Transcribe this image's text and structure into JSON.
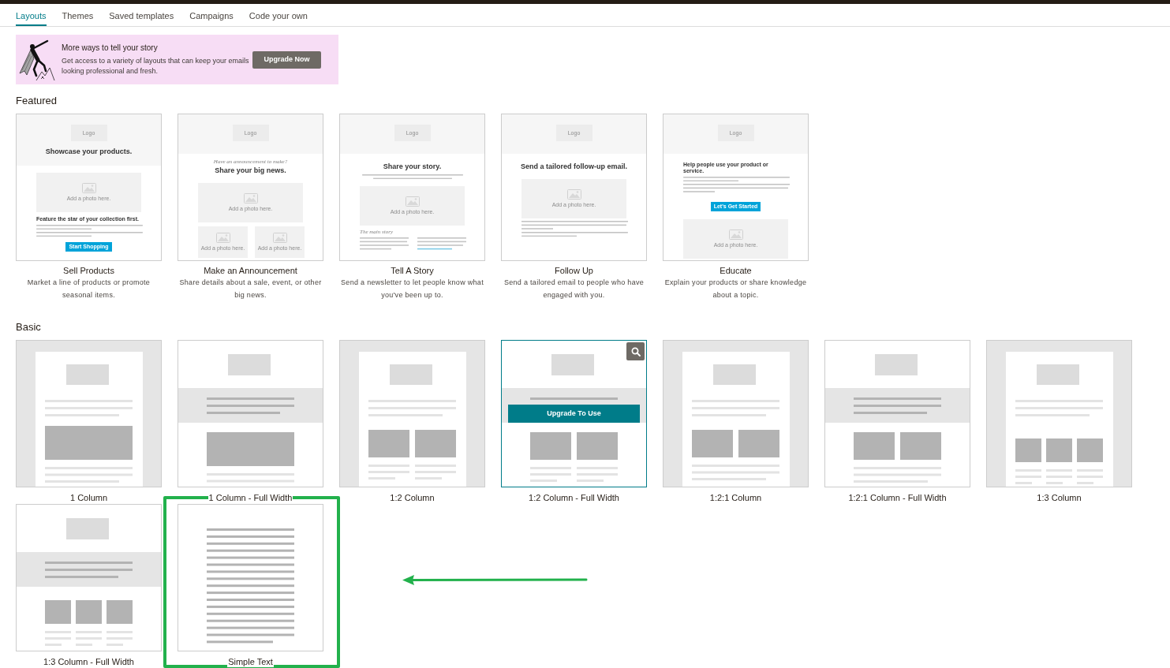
{
  "tabs": [
    {
      "label": "Layouts",
      "selected": true
    },
    {
      "label": "Themes",
      "selected": false
    },
    {
      "label": "Saved templates",
      "selected": false
    },
    {
      "label": "Campaigns",
      "selected": false
    },
    {
      "label": "Code your own",
      "selected": false
    }
  ],
  "upgrade_banner": {
    "title": "More ways to tell your story",
    "text": "Get access to a variety of layouts that can keep your emails looking professional and fresh.",
    "button": "Upgrade Now"
  },
  "featured": {
    "heading": "Featured",
    "templates": [
      {
        "name": "Sell Products",
        "description": "Market a line of products or promote seasonal items.",
        "preview": [
          {
            "kind": "header",
            "logo": "Logo",
            "title": "Showcase your products."
          },
          {
            "kind": "photo",
            "caption": "Add a photo here."
          },
          {
            "kind": "subhead",
            "text": "Feature the star of your collection first."
          },
          {
            "kind": "text2"
          },
          {
            "kind": "text2"
          },
          {
            "kind": "button",
            "text": "Start Shopping"
          }
        ]
      },
      {
        "name": "Make an Announcement",
        "description": "Share details about a sale, event, or other big news.",
        "preview": [
          {
            "kind": "header",
            "logo": "Logo"
          },
          {
            "kind": "eyebrow",
            "text": "Have an announcement to make?"
          },
          {
            "kind": "title",
            "text": "Share your big news."
          },
          {
            "kind": "photo",
            "caption": "Add a photo here."
          },
          {
            "kind": "photos",
            "captions": [
              "Add a photo here.",
              "Add a photo here."
            ]
          }
        ]
      },
      {
        "name": "Tell A Story",
        "description": "Send a newsletter to let people know what you've been up to.",
        "preview": [
          {
            "kind": "header",
            "logo": "Logo"
          },
          {
            "kind": "title",
            "text": "Share your story."
          },
          {
            "kind": "intro"
          },
          {
            "kind": "photo",
            "caption": "Add a photo here."
          },
          {
            "kind": "label",
            "text": "The main story"
          },
          {
            "kind": "columns"
          }
        ]
      },
      {
        "name": "Follow Up",
        "description": "Send a tailored email to people who have engaged with you.",
        "preview": [
          {
            "kind": "header",
            "logo": "Logo"
          },
          {
            "kind": "title",
            "text": "Send a tailored follow-up email."
          },
          {
            "kind": "photo",
            "caption": "Add a photo here."
          },
          {
            "kind": "text3"
          },
          {
            "kind": "text2"
          }
        ]
      },
      {
        "name": "Educate",
        "description": "Explain your products or share knowledge about a topic.",
        "preview": [
          {
            "kind": "header",
            "logo": "Logo"
          },
          {
            "kind": "subhead",
            "text": "Help people use your product or service."
          },
          {
            "kind": "text2"
          },
          {
            "kind": "text3"
          },
          {
            "kind": "button",
            "text": "Let's Get Started"
          },
          {
            "kind": "photo",
            "caption": "Add a photo here."
          }
        ]
      }
    ]
  },
  "basic": {
    "heading": "Basic",
    "templates": [
      {
        "name": "1 Column",
        "kind": "col1",
        "hovered": false,
        "highlighted": false
      },
      {
        "name": "1 Column - Full Width",
        "kind": "col1full",
        "hovered": false,
        "highlighted": false
      },
      {
        "name": "1:2 Column",
        "kind": "col12",
        "hovered": false,
        "highlighted": false
      },
      {
        "name": "1:2 Column - Full Width",
        "kind": "col12full",
        "hovered": true,
        "highlighted": false,
        "overlay_button": "Upgrade To Use"
      },
      {
        "name": "1:2:1 Column",
        "kind": "col121",
        "hovered": false,
        "highlighted": false
      },
      {
        "name": "1:2:1 Column - Full Width",
        "kind": "col121full",
        "hovered": false,
        "highlighted": false
      },
      {
        "name": "1:3 Column",
        "kind": "col13",
        "hovered": false,
        "highlighted": false
      },
      {
        "name": "1:3 Column - Full Width",
        "kind": "col13full",
        "hovered": false,
        "highlighted": false
      },
      {
        "name": "Simple Text",
        "kind": "text",
        "hovered": false,
        "highlighted": true
      }
    ]
  }
}
